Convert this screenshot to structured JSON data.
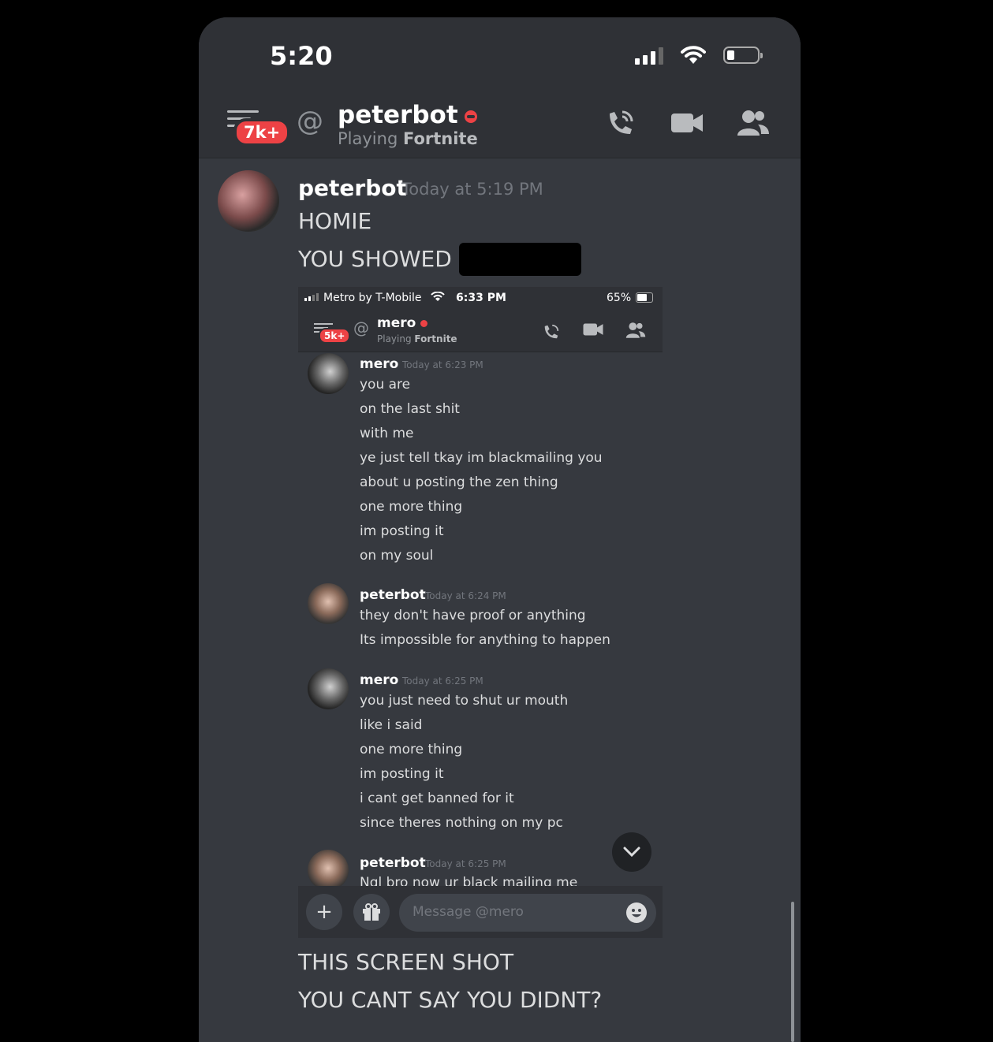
{
  "status_bar": {
    "time": "5:20"
  },
  "header": {
    "badge": "7k+",
    "username": "peterbot",
    "status_prefix": "Playing",
    "status_game": "Fortnite"
  },
  "message": {
    "author": "peterbot",
    "timestamp": "Today at 5:19 PM",
    "lines_before": [
      "HOMIE",
      "YOU SHOWED"
    ],
    "lines_after": [
      "THIS SCREEN SHOT",
      "YOU CANT SAY YOU DIDNT?"
    ]
  },
  "embedded_screenshot": {
    "status_bar": {
      "carrier": "Metro by T-Mobile",
      "time": "6:33 PM",
      "battery": "65%"
    },
    "header": {
      "badge": "5k+",
      "username": "mero",
      "status_prefix": "Playing",
      "status_game": "Fortnite"
    },
    "messages": [
      {
        "author": "mero",
        "timestamp": "Today at 6:23 PM",
        "lines": [
          "you are",
          "on the last shit",
          "with me",
          "ye just tell tkay im blackmailing you",
          "about u posting the zen thing",
          "one more thing",
          "im posting it",
          "on my soul"
        ]
      },
      {
        "author": "peterbot",
        "timestamp": "Today at 6:24 PM",
        "lines": [
          "they don't have proof or anything",
          "Its impossible for anything to happen"
        ]
      },
      {
        "author": "mero",
        "timestamp": "Today at 6:25 PM",
        "lines": [
          "you just need to shut ur mouth",
          "like i said",
          "one more thing",
          "im posting it",
          "i cant get banned for it",
          "since theres nothing on my pc"
        ]
      },
      {
        "author": "peterbot",
        "timestamp": "Today at 6:25 PM",
        "lines": [
          "Ngl bro now ur black mailing me"
        ]
      }
    ],
    "input_placeholder": "Message @mero"
  },
  "icons": [
    "menu-icon",
    "at-icon",
    "call-icon",
    "video-icon",
    "members-icon",
    "plus-icon",
    "gift-icon",
    "emoji-icon",
    "chevron-down-icon"
  ],
  "colors": {
    "background": "#36393f",
    "header": "#2f3136",
    "dnd_red": "#ed4245",
    "text": "#dcddde",
    "muted": "#72767d"
  }
}
